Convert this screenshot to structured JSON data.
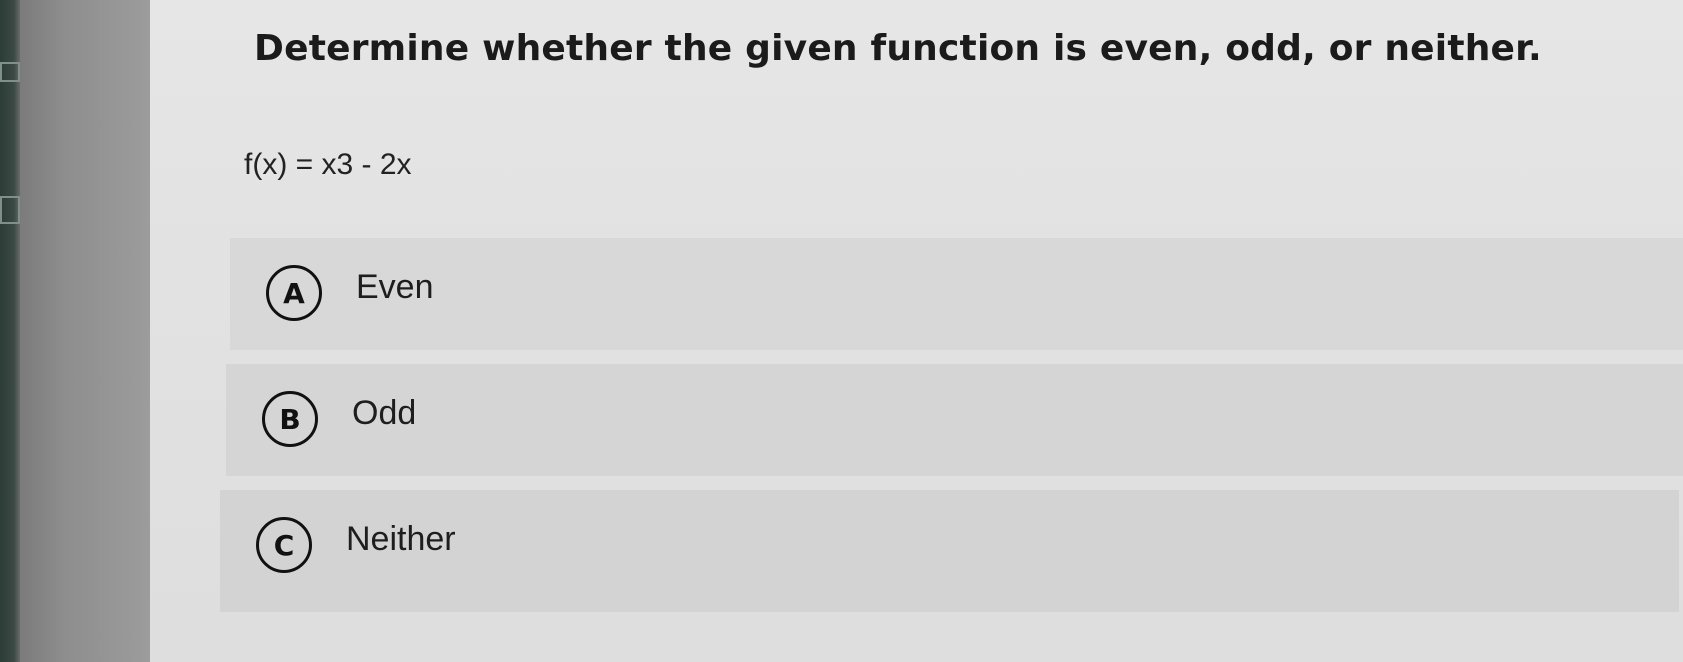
{
  "question": {
    "title": "Determine whether the given function is even, odd, or neither.",
    "function": "f(x) = x3 - 2x"
  },
  "options": [
    {
      "letter": "A",
      "label": "Even"
    },
    {
      "letter": "B",
      "label": "Odd"
    },
    {
      "letter": "C",
      "label": "Neither"
    }
  ]
}
